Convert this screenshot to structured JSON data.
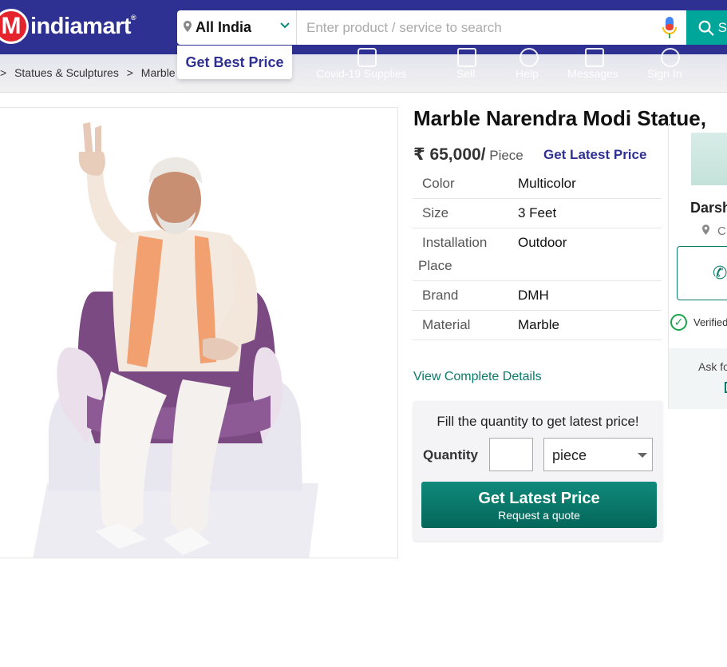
{
  "header": {
    "logo_text": "indiamart",
    "logo_mark": "M",
    "logo_reg": "®",
    "location": "All India",
    "search_placeholder": "Enter product / service to search",
    "search_button_text": "S",
    "best_price": "Get Best Price",
    "colors": {
      "brand": "#2e3192",
      "accent": "#00a699",
      "logo_red": "#e4232d"
    }
  },
  "nav": {
    "breadcrumb": [
      ">",
      "Statues & Sculptures",
      ">",
      "Marble"
    ],
    "items": [
      {
        "label": "Covid-19 Supplies",
        "icon": "shield-plus-icon"
      },
      {
        "label": "Sell",
        "icon": "store-icon"
      },
      {
        "label": "Help",
        "icon": "help-icon"
      },
      {
        "label": "Messages",
        "icon": "messages-icon"
      },
      {
        "label": "Sign In",
        "icon": "user-icon"
      }
    ]
  },
  "product": {
    "title": "Marble Narendra Modi Statue,",
    "price": "₹ 65,000/",
    "unit": " Piece",
    "latest_price_link": "Get Latest Price",
    "specs": [
      {
        "key": "Color",
        "value": "Multicolor"
      },
      {
        "key": "Size",
        "value": "3 Feet"
      },
      {
        "key": "Installation",
        "key_line2": "Place",
        "value": "Outdoor"
      },
      {
        "key": "Brand",
        "value": "DMH"
      },
      {
        "key": "Material",
        "value": "Marble"
      }
    ],
    "view_details": "View Complete Details"
  },
  "quote": {
    "title": "Fill the quantity to get latest price!",
    "quantity_label": "Quantity",
    "quantity_value": "",
    "unit_selected": "piece",
    "button_label": "Get Latest Price",
    "button_sub": "Request a quote"
  },
  "seller": {
    "name": "Darsh",
    "location": "C",
    "verified": "Verified",
    "ask": "Ask fo"
  }
}
